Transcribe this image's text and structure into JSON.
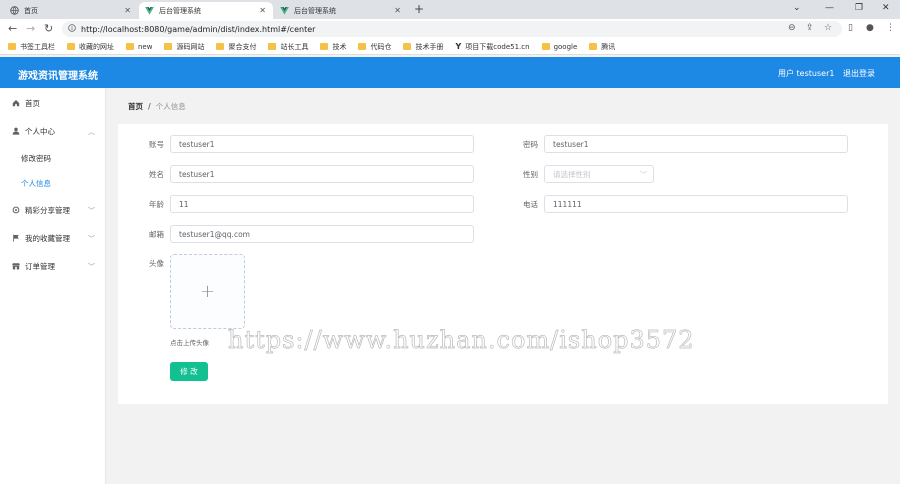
{
  "browser": {
    "tabs": [
      {
        "label": "首页",
        "icon": "globe-icon"
      },
      {
        "label": "后台管理系统",
        "icon": "vue-logo-icon"
      },
      {
        "label": "后台管理系统",
        "icon": "vue-logo-icon"
      }
    ],
    "url": "http://localhost:8080/game/admin/dist/index.html#/center",
    "bookmarks": [
      "书签工具栏",
      "收藏的网址",
      "new",
      "源码网站",
      "聚合支付",
      "站长工具",
      "技术",
      "代码仓",
      "技术手册",
      "项目下载code51.cn",
      "google",
      "腾讯"
    ]
  },
  "header": {
    "title": "游戏资讯管理系统",
    "user": "用户 testuser1",
    "logout": "退出登录",
    "bg": "#1d89e4"
  },
  "sidebar": {
    "items": [
      {
        "label": "首页",
        "icon": "home-icon"
      },
      {
        "label": "个人中心",
        "icon": "user-icon"
      },
      {
        "label": "修改密码"
      },
      {
        "label": "个人信息"
      },
      {
        "label": "精彩分享管理",
        "icon": "settings-icon"
      },
      {
        "label": "我的收藏管理",
        "icon": "flag-icon"
      },
      {
        "label": "订单管理",
        "icon": "shop-icon"
      }
    ],
    "active": "个人信息"
  },
  "breadcrumb": {
    "home": "首页",
    "separator": "/",
    "current": "个人信息"
  },
  "form": {
    "account": {
      "label": "账号",
      "value": "testuser1"
    },
    "password": {
      "label": "密码",
      "value": "testuser1"
    },
    "name": {
      "label": "姓名",
      "value": "testuser1"
    },
    "gender": {
      "label": "性别",
      "placeholder": "请选择性别"
    },
    "age": {
      "label": "年龄",
      "value": "11"
    },
    "phone": {
      "label": "电话",
      "value": "111111"
    },
    "email": {
      "label": "邮箱",
      "value": "testuser1@qq.com"
    },
    "avatar": {
      "label": "头像",
      "tip": "点击上传头像"
    },
    "submit": "修 改",
    "submit_color": "#13c08f"
  },
  "watermark": "https://www.huzhan.com/ishop3572"
}
